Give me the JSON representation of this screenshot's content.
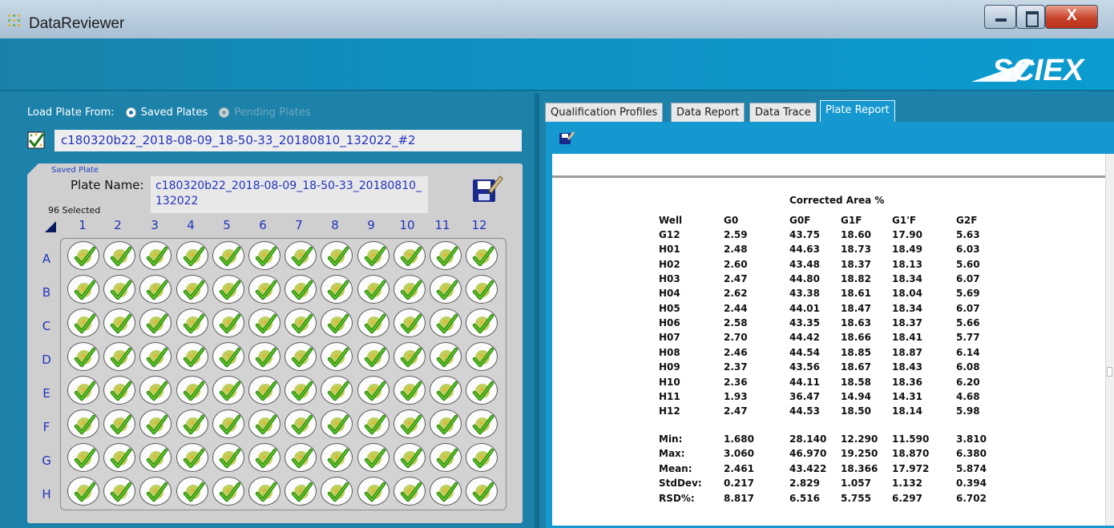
{
  "window": {
    "title": "DataReviewer"
  },
  "brand": {
    "logo_text": "SCIEX"
  },
  "left": {
    "load_label": "Load Plate From:",
    "saved_option": "Saved Plates",
    "pending_option": "Pending Plates",
    "plate_file": "c180320b22_2018-08-09_18-50-33_20180810_132022_#2",
    "saved_plate_caption": "Saved Plate",
    "plate_name_label": "Plate Name:",
    "plate_name_value": "c180320b22_2018-08-09_18-50-33_20180810_132022",
    "selected_count": "96 Selected",
    "columns": [
      "1",
      "2",
      "3",
      "4",
      "5",
      "6",
      "7",
      "8",
      "9",
      "10",
      "11",
      "12"
    ],
    "rows": [
      "A",
      "B",
      "C",
      "D",
      "E",
      "F",
      "G",
      "H"
    ]
  },
  "right": {
    "tabs": [
      "Qualification Profiles",
      "Data Report",
      "Data Trace",
      "Plate Report"
    ],
    "active_tab": "Plate Report",
    "report": {
      "title": "Corrected Area %",
      "headers": [
        "Well",
        "G0",
        "G0F",
        "G1F",
        "G1'F",
        "G2F"
      ],
      "rows": [
        [
          "G12",
          "2.59",
          "43.75",
          "18.60",
          "17.90",
          "5.63"
        ],
        [
          "H01",
          "2.48",
          "44.63",
          "18.73",
          "18.49",
          "6.03"
        ],
        [
          "H02",
          "2.60",
          "43.48",
          "18.37",
          "18.13",
          "5.60"
        ],
        [
          "H03",
          "2.47",
          "44.80",
          "18.82",
          "18.34",
          "6.07"
        ],
        [
          "H04",
          "2.62",
          "43.38",
          "18.61",
          "18.04",
          "5.69"
        ],
        [
          "H05",
          "2.44",
          "44.01",
          "18.47",
          "18.34",
          "6.07"
        ],
        [
          "H06",
          "2.58",
          "43.35",
          "18.63",
          "18.37",
          "5.66"
        ],
        [
          "H07",
          "2.70",
          "44.42",
          "18.66",
          "18.41",
          "5.77"
        ],
        [
          "H08",
          "2.46",
          "44.54",
          "18.85",
          "18.87",
          "6.14"
        ],
        [
          "H09",
          "2.37",
          "43.56",
          "18.67",
          "18.43",
          "6.08"
        ],
        [
          "H10",
          "2.36",
          "44.11",
          "18.58",
          "18.36",
          "6.20"
        ],
        [
          "H11",
          "1.93",
          "36.47",
          "14.94",
          "14.31",
          "4.68"
        ],
        [
          "H12",
          "2.47",
          "44.53",
          "18.50",
          "18.14",
          "5.98"
        ]
      ],
      "stats": [
        [
          "Min:",
          "1.680",
          "28.140",
          "12.290",
          "11.590",
          "3.810"
        ],
        [
          "Max:",
          "3.060",
          "46.970",
          "19.250",
          "18.870",
          "6.380"
        ],
        [
          "Mean:",
          "2.461",
          "43.422",
          "18.366",
          "17.972",
          "5.874"
        ],
        [
          "StdDev:",
          "0.217",
          "2.829",
          "1.057",
          "1.132",
          "0.394"
        ],
        [
          "RSD%:",
          "8.817",
          "6.516",
          "5.755",
          "6.297",
          "6.702"
        ]
      ]
    }
  },
  "colors": {
    "accent": "#1498cf",
    "text_blue": "#2233bb",
    "check_green": "#3aa01c"
  }
}
